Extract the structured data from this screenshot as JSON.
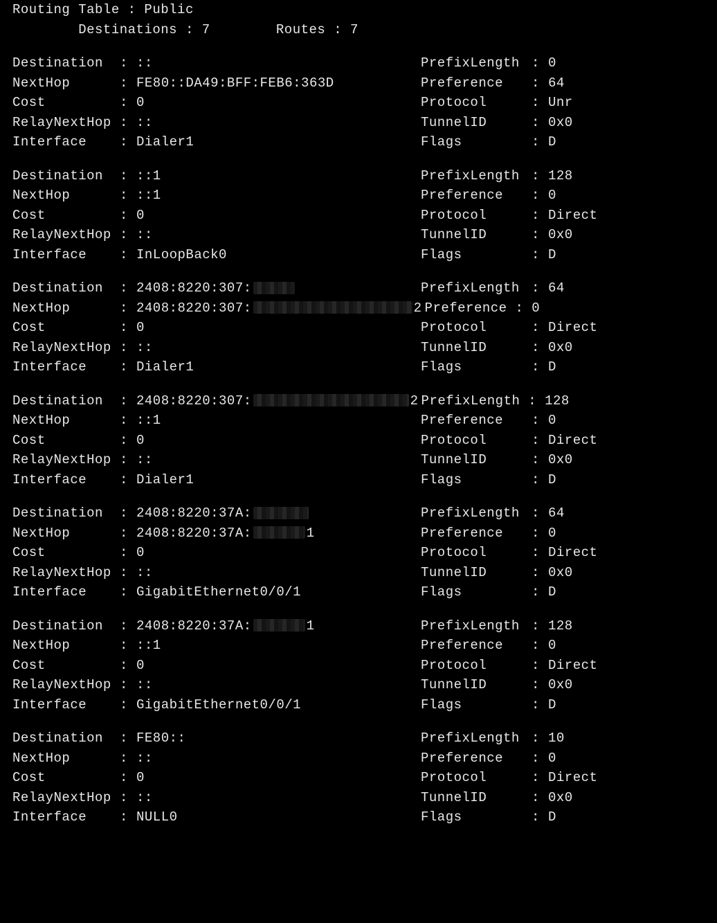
{
  "header": {
    "title": "Routing Table : Public",
    "dest_label": "Destinations :",
    "dest_value": "7",
    "routes_label": "Routes :",
    "routes_value": "7"
  },
  "labels": {
    "destination": "Destination",
    "nexthop": "NextHop",
    "cost": "Cost",
    "relaynexthop": "RelayNextHop",
    "interface": "Interface",
    "prefixlength": "PrefixLength",
    "preference": "Preference",
    "protocol": "Protocol",
    "tunnelid": "TunnelID",
    "flags": "Flags"
  },
  "routes": [
    {
      "destination": "::",
      "nexthop": "FE80::DA49:BFF:FEB6:363D",
      "cost": "0",
      "relaynexthop": "::",
      "interface": "Dialer1",
      "prefixlength": "0",
      "preference": "64",
      "protocol": "Unr",
      "tunnelid": "0x0",
      "flags": "D",
      "dest_redacted": false,
      "nexthop_redacted": false
    },
    {
      "destination": "::1",
      "nexthop": "::1",
      "cost": "0",
      "relaynexthop": "::",
      "interface": "InLoopBack0",
      "prefixlength": "128",
      "preference": "0",
      "protocol": "Direct",
      "tunnelid": "0x0",
      "flags": "D",
      "dest_redacted": false,
      "nexthop_redacted": false
    },
    {
      "destination": "2408:8220:307:",
      "nexthop": "2408:8220:307:",
      "nexthop_suffix": "2",
      "cost": "0",
      "relaynexthop": "::",
      "interface": "Dialer1",
      "prefixlength": "64",
      "preference": "0",
      "protocol": "Direct",
      "tunnelid": "0x0",
      "flags": "D",
      "dest_redacted": true,
      "dest_redact_class": "r60",
      "nexthop_redacted": true,
      "nexthop_redact_class": "r230",
      "inline_preference": true
    },
    {
      "destination": "2408:8220:307:",
      "dest_suffix": "2",
      "nexthop": "::1",
      "cost": "0",
      "relaynexthop": "::",
      "interface": "Dialer1",
      "prefixlength": "128",
      "preference": "0",
      "protocol": "Direct",
      "tunnelid": "0x0",
      "flags": "D",
      "dest_redacted": true,
      "dest_redact_class": "r225",
      "nexthop_redacted": false,
      "inline_prefixlength": true
    },
    {
      "destination": "2408:8220:37A:",
      "nexthop": "2408:8220:37A:",
      "nexthop_suffix": "1",
      "cost": "0",
      "relaynexthop": "::",
      "interface": "GigabitEthernet0/0/1",
      "prefixlength": "64",
      "preference": "0",
      "protocol": "Direct",
      "tunnelid": "0x0",
      "flags": "D",
      "dest_redacted": true,
      "dest_redact_class": "r80",
      "nexthop_redacted": true,
      "nexthop_redact_class": "r75"
    },
    {
      "destination": "2408:8220:37A:",
      "dest_suffix": "1",
      "nexthop": "::1",
      "cost": "0",
      "relaynexthop": "::",
      "interface": "GigabitEthernet0/0/1",
      "prefixlength": "128",
      "preference": "0",
      "protocol": "Direct",
      "tunnelid": "0x0",
      "flags": "D",
      "dest_redacted": true,
      "dest_redact_class": "r75",
      "nexthop_redacted": false
    },
    {
      "destination": "FE80::",
      "nexthop": "::",
      "cost": "0",
      "relaynexthop": "::",
      "interface": "NULL0",
      "prefixlength": "10",
      "preference": "0",
      "protocol": "Direct",
      "tunnelid": "0x0",
      "flags": "D",
      "dest_redacted": false,
      "nexthop_redacted": false
    }
  ]
}
